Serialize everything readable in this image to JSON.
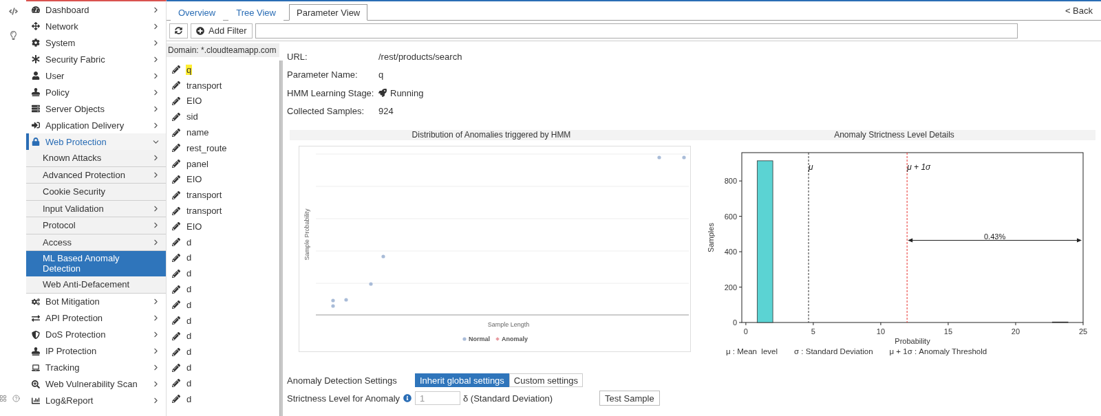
{
  "sidebar": {
    "items": [
      {
        "label": "Dashboard",
        "selected": false,
        "expanded": false
      },
      {
        "label": "Network",
        "selected": false,
        "expanded": false
      },
      {
        "label": "System",
        "selected": false,
        "expanded": false
      },
      {
        "label": "Security Fabric",
        "selected": false,
        "expanded": false
      },
      {
        "label": "User",
        "selected": false,
        "expanded": false
      },
      {
        "label": "Policy",
        "selected": false,
        "expanded": false
      },
      {
        "label": "Server Objects",
        "selected": false,
        "expanded": false
      },
      {
        "label": "Application Delivery",
        "selected": false,
        "expanded": false
      },
      {
        "label": "Web Protection",
        "selected": true,
        "expanded": true,
        "children": [
          {
            "label": "Known Attacks",
            "has_submenu": true,
            "selected": false
          },
          {
            "label": "Advanced Protection",
            "has_submenu": true,
            "selected": false
          },
          {
            "label": "Cookie Security",
            "has_submenu": false,
            "selected": false
          },
          {
            "label": "Input Validation",
            "has_submenu": true,
            "selected": false
          },
          {
            "label": "Protocol",
            "has_submenu": true,
            "selected": false
          },
          {
            "label": "Access",
            "has_submenu": true,
            "selected": false
          },
          {
            "label": "ML Based Anomaly Detection",
            "has_submenu": false,
            "selected": true
          },
          {
            "label": "Web Anti-Defacement",
            "has_submenu": false,
            "selected": false
          }
        ]
      },
      {
        "label": "Bot Mitigation",
        "selected": false,
        "expanded": false
      },
      {
        "label": "API Protection",
        "selected": false,
        "expanded": false
      },
      {
        "label": "DoS Protection",
        "selected": false,
        "expanded": false
      },
      {
        "label": "IP Protection",
        "selected": false,
        "expanded": false
      },
      {
        "label": "Tracking",
        "selected": false,
        "expanded": false
      },
      {
        "label": "Web Vulnerability Scan",
        "selected": false,
        "expanded": false
      },
      {
        "label": "Log&Report",
        "selected": false,
        "expanded": false
      }
    ]
  },
  "tabs": [
    {
      "label": "Overview",
      "selected": false
    },
    {
      "label": "Tree View",
      "selected": false
    },
    {
      "label": "Parameter View",
      "selected": true
    }
  ],
  "back_link": "< Back",
  "toolbar": {
    "add_filter": "Add Filter"
  },
  "parameters": {
    "domain": "Domain: *.cloudteamapp.com",
    "items": [
      {
        "name": "q",
        "selected": true
      },
      {
        "name": "transport",
        "selected": false
      },
      {
        "name": "EIO",
        "selected": false
      },
      {
        "name": "sid",
        "selected": false
      },
      {
        "name": "name",
        "selected": false
      },
      {
        "name": "rest_route",
        "selected": false
      },
      {
        "name": "panel",
        "selected": false
      },
      {
        "name": "EIO",
        "selected": false
      },
      {
        "name": "transport",
        "selected": false
      },
      {
        "name": "transport",
        "selected": false
      },
      {
        "name": "EIO",
        "selected": false
      },
      {
        "name": "d",
        "selected": false
      },
      {
        "name": "d",
        "selected": false
      },
      {
        "name": "d",
        "selected": false
      },
      {
        "name": "d",
        "selected": false
      },
      {
        "name": "d",
        "selected": false
      },
      {
        "name": "d",
        "selected": false
      },
      {
        "name": "d",
        "selected": false
      },
      {
        "name": "d",
        "selected": false
      },
      {
        "name": "d",
        "selected": false
      },
      {
        "name": "d",
        "selected": false
      },
      {
        "name": "d",
        "selected": false
      }
    ]
  },
  "details": [
    {
      "label": "URL:",
      "value": "/rest/products/search",
      "kind": "plain"
    },
    {
      "label": "Parameter Name:",
      "value": "q",
      "kind": "plain"
    },
    {
      "label": "HMM Learning Stage:",
      "value": "Running",
      "kind": "status"
    },
    {
      "label": "Collected Samples:",
      "value": "924",
      "kind": "plain"
    }
  ],
  "scatter": {
    "title": "Distribution of Anomalies triggered by HMM",
    "xlabel": "Sample Length",
    "ylabel": "Sample Probability",
    "legend": [
      {
        "label": "Normal",
        "color": "#a9bcd8",
        "kind": "circle"
      },
      {
        "label": "Anomaly",
        "color": "#e89aa0",
        "kind": "diamond"
      }
    ]
  },
  "histogram": {
    "chart_data": {
      "type": "bar",
      "title": "Anomaly Strictness Level Details",
      "xlabel": "Probability",
      "ylabel": "Samples",
      "x": [
        1.42,
        23.3
      ],
      "series": [
        {
          "color": "#5bd3d3",
          "values": [
            914,
            3
          ]
        }
      ],
      "xlim": [
        -0.3,
        25
      ],
      "ylim": [
        0,
        960
      ],
      "xticks": [
        0,
        5,
        10,
        15,
        20,
        25
      ],
      "yticks": [
        0,
        200,
        400,
        600,
        800
      ],
      "ref_lines": [
        {
          "axis": "x",
          "value": 4.65,
          "label": "μ",
          "color": "#333333"
        },
        {
          "axis": "x",
          "value": 11.95,
          "label": "μ + 1σ",
          "color": "#e8322f"
        }
      ],
      "annotations": [
        "0.43%"
      ]
    },
    "notes": [
      "μ : Mean  level",
      "σ : Standard Deviation",
      "μ + 1σ : Anomaly Threshold"
    ]
  },
  "settings": {
    "mode_label": "Anomaly Detection Settings",
    "modes": [
      {
        "label": "Inherit global settings",
        "selected": true
      },
      {
        "label": "Custom settings",
        "selected": false
      }
    ],
    "strictness_label": "Strictness Level for Anomaly",
    "strictness_value": "1",
    "strictness_disabled": true,
    "unit": "δ (Standard Deviation)",
    "test_button": "Test Sample"
  }
}
